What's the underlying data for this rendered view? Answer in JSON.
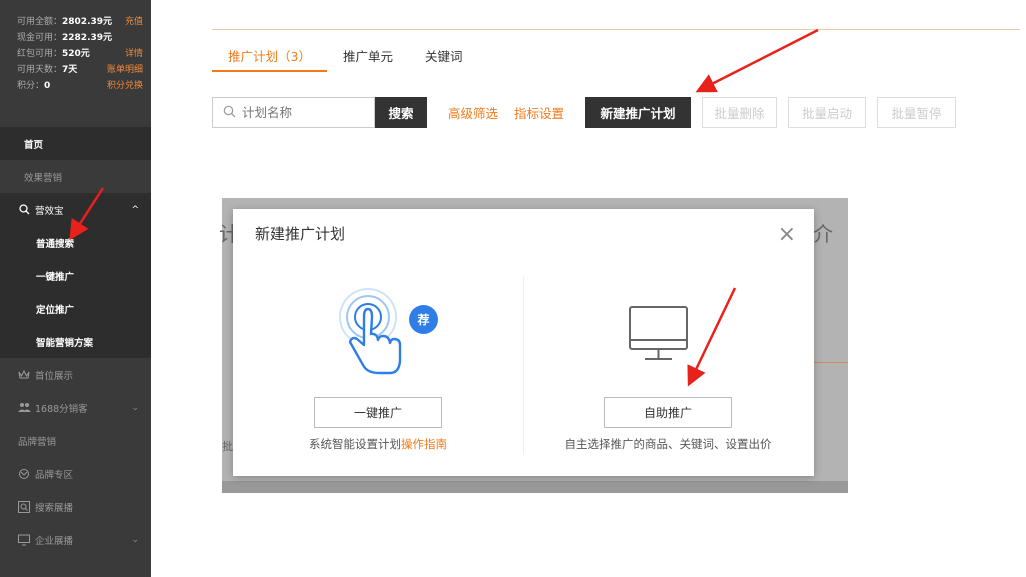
{
  "sidebar": {
    "account": [
      {
        "label": "可用全额：",
        "value": "2802.39元",
        "link": "充值"
      },
      {
        "label": "现金可用：",
        "value": "2282.39元",
        "link": ""
      },
      {
        "label": "红包可用：",
        "value": "520元",
        "link": "详情"
      },
      {
        "label": "可用天数：",
        "value": "7天",
        "link": "账单明细"
      },
      {
        "label": "积分：",
        "value": "0",
        "link": "积分兑换"
      }
    ],
    "nav": {
      "home": "首页",
      "effect_marketing": "效果营销",
      "yingxiaobao": "营效宝",
      "normal_search": "普通搜索",
      "one_click": "一键推广",
      "targeted": "定位推广",
      "smart_plan": "智能营销方案",
      "top_display": "首位展示",
      "distributor": "1688分销客",
      "brand_marketing": "品牌营销",
      "brand_zone": "品牌专区",
      "search_display": "搜索展播",
      "enterprise_display": "企业展播"
    }
  },
  "tabs": {
    "plan": "推广计划（3）",
    "unit": "推广单元",
    "keyword": "关键词"
  },
  "toolbar": {
    "search_placeholder": "计划名称",
    "search_btn": "搜索",
    "advanced_filter": "高级筛选",
    "metric_settings": "指标设置",
    "new_plan": "新建推广计划",
    "batch_delete": "批量删除",
    "batch_start": "批量启动",
    "batch_pause": "批量暂停"
  },
  "background": {
    "ghost_left": "计",
    "ghost_right": "介",
    "ghost_left_small": "批"
  },
  "dialog": {
    "title": "新建推广计划",
    "close": "×",
    "recommend_badge": "荐",
    "left": {
      "button": "一键推广",
      "desc": "系统智能设置计划",
      "guide": "操作指南"
    },
    "right": {
      "button": "自助推广",
      "desc": "自主选择推广的商品、关键词、设置出价"
    }
  },
  "colors": {
    "accent": "#f07b1a",
    "sidebar_bg": "#3a3a3a",
    "arrow": "#e8221b",
    "badge_blue": "#2f7ee8"
  }
}
